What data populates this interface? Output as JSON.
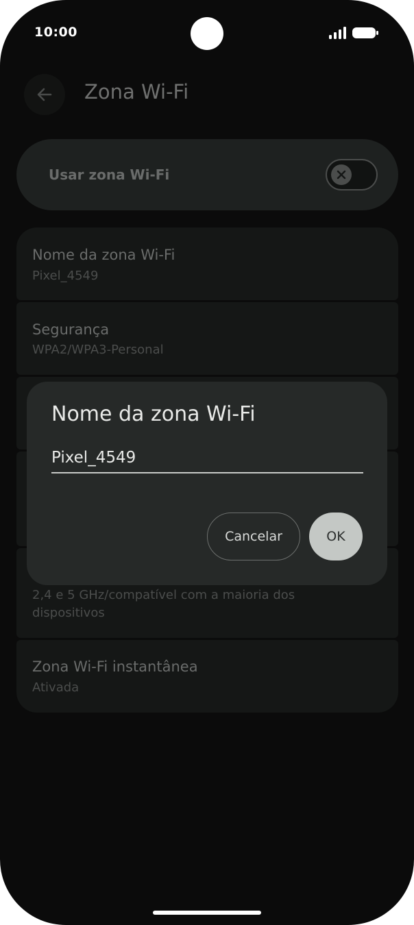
{
  "status_bar": {
    "time": "10:00",
    "signal_icon": "signal-bars-icon",
    "battery_icon": "battery-icon"
  },
  "app_bar": {
    "back_icon": "arrow-back-icon",
    "title": "Zona Wi-Fi"
  },
  "hotspot_toggle": {
    "label": "Usar zona Wi-Fi",
    "state": "off",
    "knob_icon": "close-icon"
  },
  "settings": [
    {
      "title": "Nome da zona Wi-Fi",
      "subtitle": "Pixel_4549"
    },
    {
      "title": "Segurança",
      "subtitle": "WPA2/WPA3-Personal"
    },
    {
      "title": "",
      "subtitle": ""
    },
    {
      "title": "",
      "subtitle": ""
    },
    {
      "title": "",
      "subtitle": "2,4 e 5 GHz/compatível com a maioria dos dispositivos"
    },
    {
      "title": "Zona Wi-Fi instantânea",
      "subtitle": "Ativada"
    }
  ],
  "dialog": {
    "title": "Nome da zona Wi-Fi",
    "input_value": "Pixel_4549",
    "cancel_label": "Cancelar",
    "ok_label": "OK"
  },
  "colors": {
    "background": "#0b0b0b",
    "dialog_surface": "#262928",
    "primary_button": "#c4c8c5",
    "dialog_text": "#e9eae8"
  }
}
